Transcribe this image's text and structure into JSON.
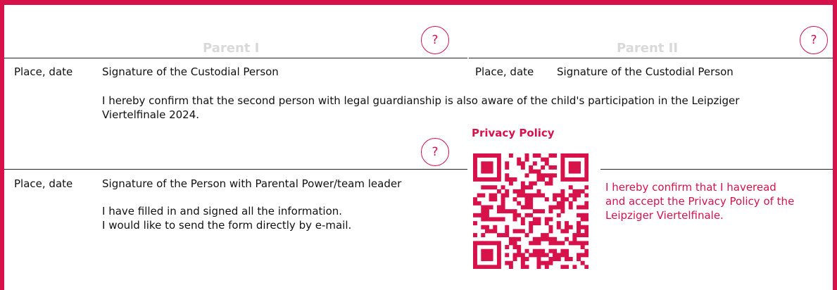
{
  "sections": {
    "parent1_label": "Parent I",
    "parent2_label": "Parent II"
  },
  "signature_rows": {
    "row1_left_place_date": "Place, date",
    "row1_left_signature": "Signature of the Custodial Person",
    "row1_right_place_date": "Place, date",
    "row1_right_signature": "Signature of the Custodial Person",
    "row2_place_date": "Place, date",
    "row2_signature": "Signature of the Person with Parental Power/team leader"
  },
  "help_icons": {
    "symbol": "?"
  },
  "confirmations": {
    "guardianship_line1": "I hereby confirm that the second person with legal guardianship is also aware of the child's participation in the Leipziger",
    "guardianship_line2": "Viertelfinale 2024.",
    "filled_in": "I have filled in and signed all the information.",
    "send_email": "I would like to send the form directly by e-mail."
  },
  "privacy": {
    "title": "Privacy Policy",
    "line1": "I hereby confirm that I haveread",
    "line2": "and accept the Privacy Policy of the",
    "line3": "Leipziger Viertelfinale.",
    "qr_icon": "qr-code-icon"
  },
  "colors": {
    "accent": "#d7124b",
    "muted_label": "#d9d9d9",
    "rule": "#222222"
  }
}
